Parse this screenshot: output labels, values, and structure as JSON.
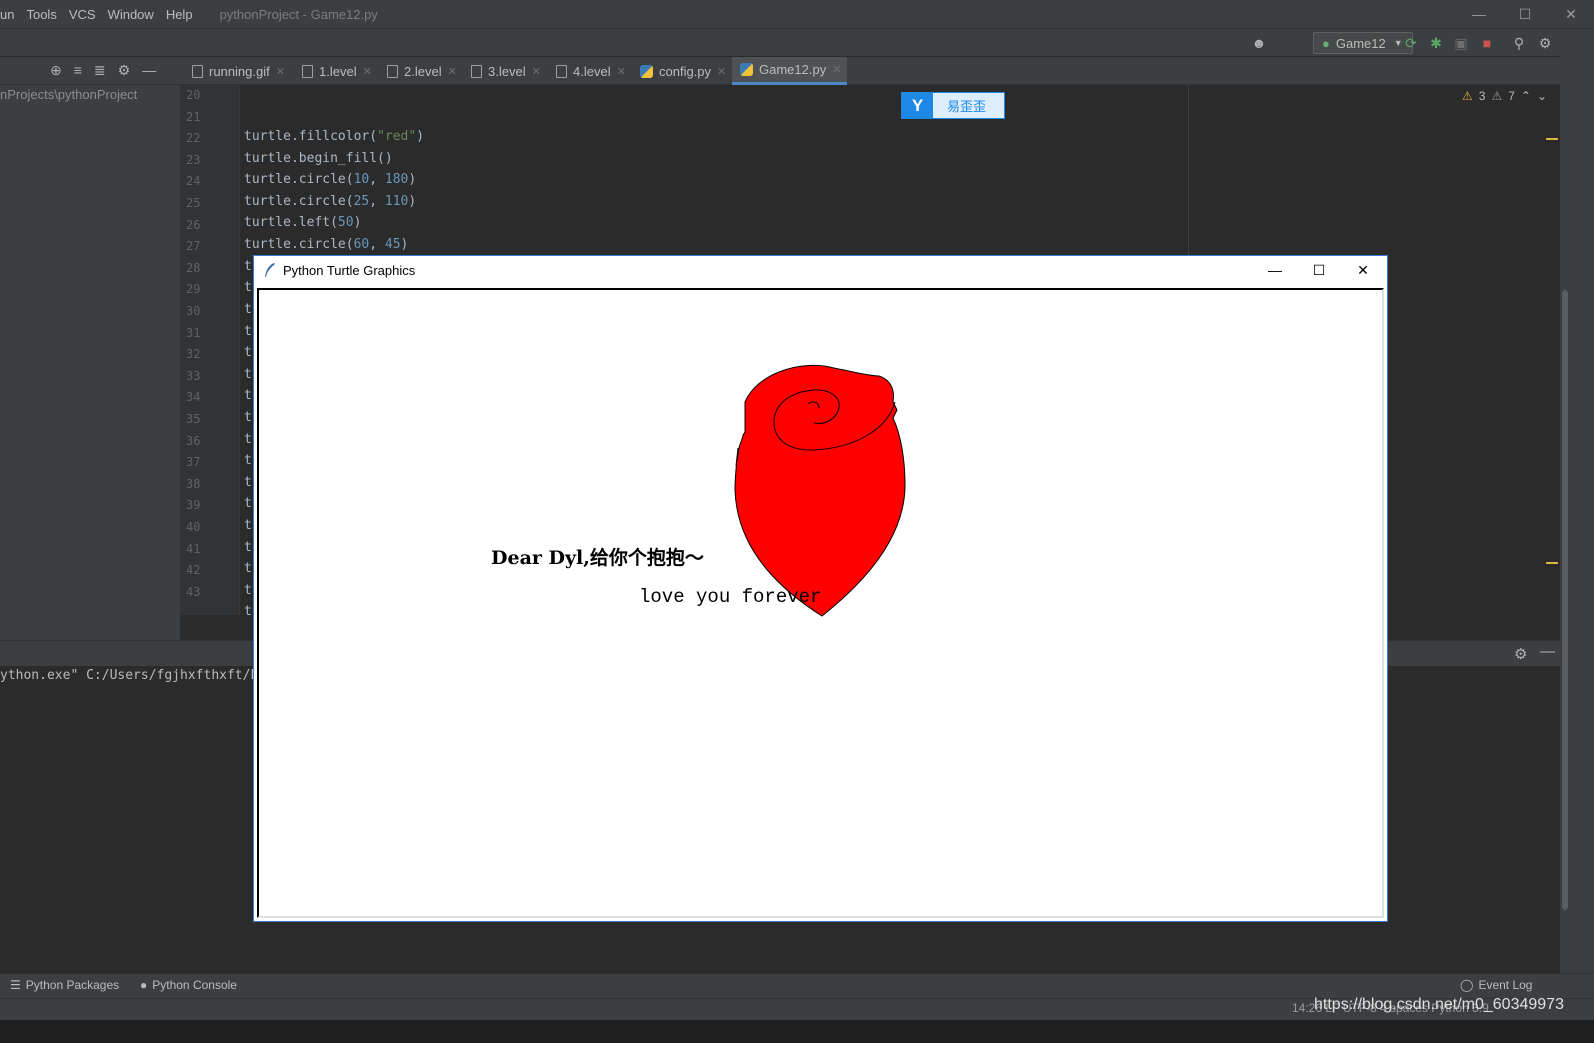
{
  "menubar": {
    "items": [
      "un",
      "Tools",
      "VCS",
      "Window",
      "Help"
    ],
    "window_title": "pythonProject - Game12.py"
  },
  "toolbar": {
    "run_config": "Game12"
  },
  "tabs": [
    {
      "label": "running.gif",
      "icon": "file-icon"
    },
    {
      "label": "1.level",
      "icon": "file-icon"
    },
    {
      "label": "2.level",
      "icon": "file-icon"
    },
    {
      "label": "3.level",
      "icon": "file-icon"
    },
    {
      "label": "4.level",
      "icon": "file-icon"
    },
    {
      "label": "config.py",
      "icon": "python-file-icon"
    },
    {
      "label": "Game12.py",
      "icon": "python-file-icon",
      "active": true
    }
  ],
  "project": {
    "path": "nProjects\\pythonProject"
  },
  "editor": {
    "line_numbers": [
      "20",
      "21",
      "22",
      "23",
      "24",
      "25",
      "26",
      "27",
      "28",
      "29",
      "30",
      "31",
      "32",
      "33",
      "34",
      "35",
      "36",
      "37",
      "38",
      "39",
      "40",
      "41",
      "42",
      "43",
      "44"
    ],
    "code_lines": [
      "",
      "",
      "turtle.fillcolor(\"red\")",
      "turtle.begin_fill()",
      "turtle.circle(10, 180)",
      "turtle.circle(25, 110)",
      "turtle.left(50)",
      "turtle.circle(60, 45)",
      "t",
      "t",
      "t",
      "t",
      "t",
      "t",
      "t",
      "t",
      "t",
      "t",
      "t",
      "t",
      "t",
      "t",
      "t",
      "t",
      "t"
    ],
    "warnings_a": "3",
    "warnings_b": "7"
  },
  "translate_widget": {
    "logo": "Y",
    "label": "易歪歪"
  },
  "console": {
    "text": "ython.exe\" C:/Users/fgjhxfthxft/P"
  },
  "bottom_tools": {
    "python_packages": "Python Packages",
    "python_console": "Python Console",
    "event_log": "Event Log"
  },
  "statusbar": {
    "position": "14:26  LF  UTF-8  4 spaces  Python 3.9"
  },
  "watermark": "https://blog.csdn.net/m0_60349973",
  "turtle_window": {
    "title": "Python Turtle Graphics",
    "greeting": "Dear Dyl,给你个抱抱～",
    "love": "love you forever",
    "rose_color": "#ff0000"
  }
}
